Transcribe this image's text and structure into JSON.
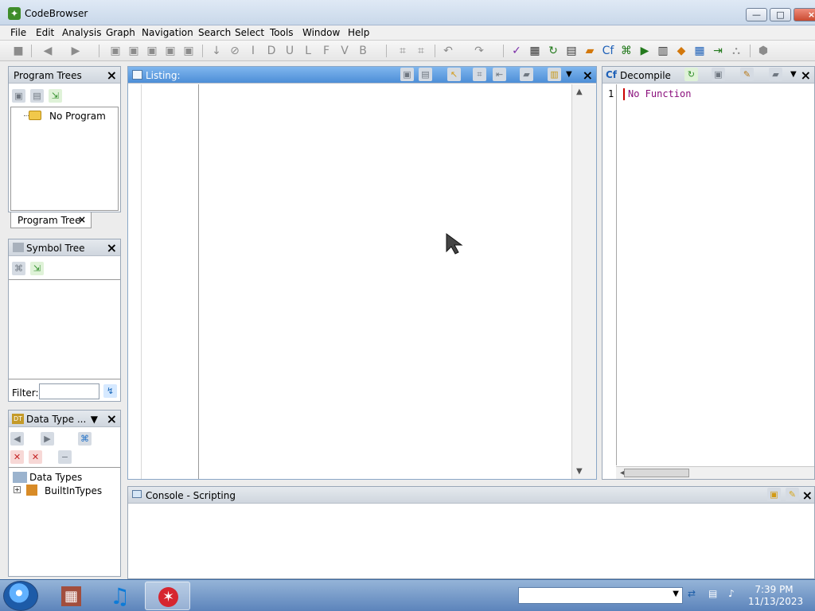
{
  "window": {
    "title": "CodeBrowser",
    "minimize": "—",
    "maximize": "□",
    "close": "×"
  },
  "menu": [
    "File",
    "Edit",
    "Analysis",
    "Graph",
    "Navigation",
    "Search",
    "Select",
    "Tools",
    "Window",
    "Help"
  ],
  "toolbar": {
    "icons": [
      "save-icon",
      "back-icon",
      "forward-icon",
      "bookmark-icon",
      "down-arrow-icon",
      "stop-icon",
      "I",
      "D",
      "U",
      "L",
      "F",
      "V",
      "B",
      "undo-icon",
      "redo-icon",
      "check-icon",
      "binary-icon",
      "refresh-icon",
      "table-icon",
      "folder-icon",
      "c-function-icon",
      "graph-icon",
      "play-icon",
      "chip-icon",
      "diamond-icon",
      "grid-icon",
      "export-icon",
      "network-icon",
      "plugin-icon"
    ]
  },
  "program_trees": {
    "title": "Program Trees",
    "item": "No Program",
    "tab": "Program Tree"
  },
  "symbol_tree": {
    "title": "Symbol Tree",
    "filter_label": "Filter:",
    "filter_value": ""
  },
  "data_type_manager": {
    "title": "Data Type ...",
    "root": "Data Types",
    "child": "BuiltInTypes"
  },
  "listing": {
    "title": "Listing:"
  },
  "decompile": {
    "title": "Decompile",
    "line_number": "1",
    "text": "No Function"
  },
  "console": {
    "title": "Console - Scripting"
  },
  "taskbar": {
    "time": "7:39 PM",
    "date": "11/13/2023"
  }
}
